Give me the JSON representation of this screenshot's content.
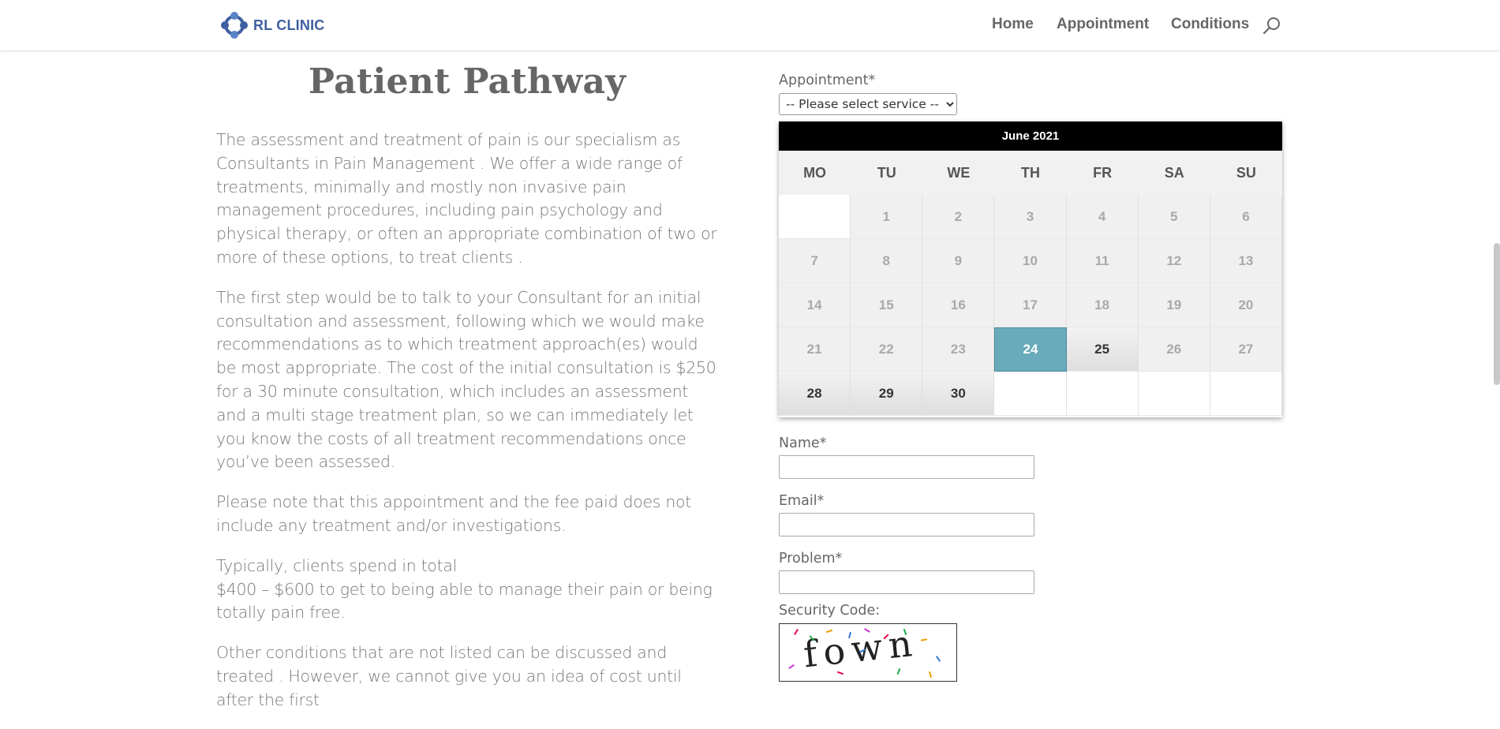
{
  "header": {
    "logo_text": "RL CLINIC",
    "nav": [
      {
        "label": "Home"
      },
      {
        "label": "Appointment"
      },
      {
        "label": "Conditions"
      }
    ],
    "search_icon": "search-icon"
  },
  "main": {
    "title": "Patient Pathway",
    "paragraphs": [
      "The assessment and treatment of pain is our specialism as Consultants in Pain Management . We offer a wide range of treatments, minimally and mostly non invasive pain management procedures, including pain psychology and physical therapy, or often an appropriate combination of two or more of these options, to treat clients .",
      "The first step would be to talk to your Consultant for an initial consultation and assessment, following which we would make recommendations as to which treatment approach(es) would be most appropriate. The cost of the initial consultation is $250 for a 30 minute consultation, which includes an assessment and a multi stage treatment plan, so we can immediately let you know the costs of all treatment recommendations once you’ve been assessed.",
      "Please note that this appointment and the fee paid does not include any treatment and/or investigations.",
      "Typically, clients spend in total\n$400 – $600 to get to being able to manage their pain or being totally pain free.",
      "Other conditions that are not listed can be discussed and treated . However, we cannot give you an idea of cost until after the first"
    ]
  },
  "form": {
    "appointment_label": "Appointment*",
    "service_select_value": "-- Please select service --",
    "calendar": {
      "month": "June 2021",
      "weekdays": [
        "MO",
        "TU",
        "WE",
        "TH",
        "FR",
        "SA",
        "SU"
      ],
      "days": [
        {
          "label": "",
          "state": "empty"
        },
        {
          "label": "1",
          "state": "disabled"
        },
        {
          "label": "2",
          "state": "disabled"
        },
        {
          "label": "3",
          "state": "disabled"
        },
        {
          "label": "4",
          "state": "disabled"
        },
        {
          "label": "5",
          "state": "disabled"
        },
        {
          "label": "6",
          "state": "disabled"
        },
        {
          "label": "7",
          "state": "disabled"
        },
        {
          "label": "8",
          "state": "disabled"
        },
        {
          "label": "9",
          "state": "disabled"
        },
        {
          "label": "10",
          "state": "disabled"
        },
        {
          "label": "11",
          "state": "disabled"
        },
        {
          "label": "12",
          "state": "disabled"
        },
        {
          "label": "13",
          "state": "disabled"
        },
        {
          "label": "14",
          "state": "disabled"
        },
        {
          "label": "15",
          "state": "disabled"
        },
        {
          "label": "16",
          "state": "disabled"
        },
        {
          "label": "17",
          "state": "disabled"
        },
        {
          "label": "18",
          "state": "disabled"
        },
        {
          "label": "19",
          "state": "disabled"
        },
        {
          "label": "20",
          "state": "disabled"
        },
        {
          "label": "21",
          "state": "disabled"
        },
        {
          "label": "22",
          "state": "disabled"
        },
        {
          "label": "23",
          "state": "disabled"
        },
        {
          "label": "24",
          "state": "selected"
        },
        {
          "label": "25",
          "state": "available"
        },
        {
          "label": "26",
          "state": "disabled"
        },
        {
          "label": "27",
          "state": "disabled"
        },
        {
          "label": "28",
          "state": "available"
        },
        {
          "label": "29",
          "state": "available"
        },
        {
          "label": "30",
          "state": "available"
        },
        {
          "label": "",
          "state": "empty"
        },
        {
          "label": "",
          "state": "empty"
        },
        {
          "label": "",
          "state": "empty"
        },
        {
          "label": "",
          "state": "empty"
        }
      ],
      "selected_color": "#6aabbb"
    },
    "name_label": "Name*",
    "email_label": "Email*",
    "problem_label": "Problem*",
    "security_label": "Security Code:",
    "captcha_text": "fown"
  },
  "colors": {
    "logo": "#3f5fa0",
    "calendar_header": "#000000"
  }
}
